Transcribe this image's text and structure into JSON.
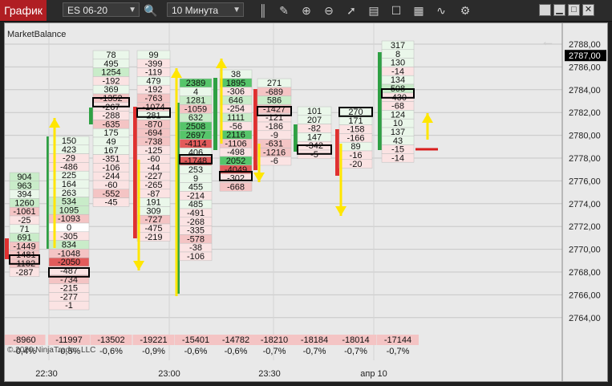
{
  "app_title": "График",
  "instrument": "ES 06-20",
  "interval": "10 Минута",
  "indicator": "MarketBalance",
  "copyright": "© 2020 NinjaTrader, LLC",
  "toolbar_icons": [
    "search-icon",
    "bar-type-icon",
    "draw-pencil-icon",
    "zoom-in-icon",
    "zoom-out-icon",
    "pointer-icon",
    "properties-icon",
    "data-box-icon",
    "strategy-icon",
    "settings-icon"
  ],
  "colors": {
    "up": "#2ea043",
    "down": "#e03030",
    "arrow": "#ffe600",
    "price_marker": "#d91e1e"
  },
  "chart_data": {
    "type": "footprint",
    "y_axis": {
      "min": 2763,
      "max": 2789,
      "ticks": [
        "2788,00",
        "2786,00",
        "2784,00",
        "2782,00",
        "2780,00",
        "2778,00",
        "2776,00",
        "2774,00",
        "2772,00",
        "2770,00",
        "2768,00",
        "2766,00",
        "2764,00"
      ]
    },
    "current_price": "2787,00",
    "x_labels": [
      "22:30",
      "23:00",
      "23:30",
      "апр 10"
    ],
    "bars": [
      {
        "cells": [
          "904",
          "963",
          "394",
          "1260",
          "-1061",
          "-25",
          "71",
          "691",
          "-1449",
          "-1481",
          "-1182",
          "-287"
        ],
        "totals": [
          "-8960",
          "-0,4%"
        ]
      },
      {
        "cells": [
          "150",
          "423",
          "-29",
          "-486",
          "225",
          "164",
          "263",
          "534",
          "1095",
          "-1093",
          "0",
          "-305",
          "834",
          "-1048",
          "-2050",
          "-487",
          "-734",
          "-215",
          "-277",
          "-1"
        ],
        "totals": [
          "-11997",
          "-0,5%"
        ]
      },
      {
        "cells": [
          "78",
          "495",
          "1254",
          "-192",
          "369",
          "-1352",
          "-267",
          "-288",
          "-635",
          "175",
          "49",
          "167",
          "-351",
          "-106",
          "-244",
          "-60",
          "-552",
          "-45"
        ],
        "totals": [
          "-13502",
          "-0,6%"
        ]
      },
      {
        "cells": [
          "99",
          "-399",
          "-119",
          "479",
          "-192",
          "-763",
          "-1074",
          "281",
          "-870",
          "-694",
          "-738",
          "-125",
          "-60",
          "-44",
          "-227",
          "-265",
          "-87",
          "191",
          "309",
          "-727",
          "-475",
          "-219"
        ],
        "totals": [
          "-19221",
          "-0,9%"
        ]
      },
      {
        "cells": [
          "2389",
          "4",
          "1281",
          "-1059",
          "632",
          "2508",
          "2697",
          "-4114",
          "406",
          "-1748",
          "253",
          "9",
          "455",
          "-214",
          "485",
          "-491",
          "-268",
          "-335",
          "-578",
          "-38",
          "-106"
        ],
        "totals": [
          "-15401",
          "-0,6%"
        ]
      },
      {
        "cells": [
          "38",
          "1895",
          "-306",
          "646",
          "-254",
          "1111",
          "-56",
          "2116",
          "-1106",
          "-498",
          "2052",
          "-4049",
          "-302",
          "-668"
        ],
        "totals": [
          "-14782",
          "-0,6%"
        ]
      },
      {
        "cells": [
          "271",
          "-689",
          "586",
          "-1427",
          "-121",
          "-186",
          "-9",
          "-631",
          "-1216",
          "-6"
        ],
        "totals": [
          "-18210",
          "-0,7%"
        ]
      },
      {
        "cells": [
          "101",
          "207",
          "-82",
          "147",
          "-342",
          "-5"
        ],
        "totals": [
          "-18184",
          "-0,7%"
        ]
      },
      {
        "cells": [
          "270",
          "171",
          "-158",
          "-166",
          "89",
          "-16",
          "-20"
        ],
        "totals": [
          "-18014",
          "-0,7%"
        ]
      },
      {
        "cells": [
          "317",
          "8",
          "130",
          "-14",
          "134",
          "508",
          "-430",
          "-68",
          "124",
          "10",
          "137",
          "43",
          "-15",
          "-14"
        ],
        "totals": [
          "-17144",
          "-0,7%"
        ]
      }
    ]
  }
}
